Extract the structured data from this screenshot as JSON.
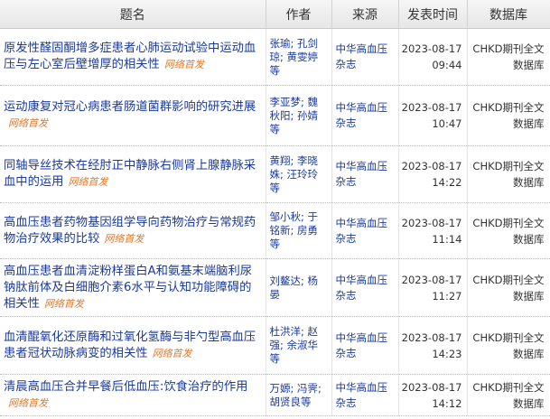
{
  "header": {
    "title": "题名",
    "author": "作者",
    "source": "来源",
    "date": "发表时间",
    "db": "数据库"
  },
  "badge": "网络首发",
  "rows": [
    {
      "title": "原发性醛固酮增多症患者心肺运动试验中运动血压与左心室后壁增厚的相关性",
      "author": "张瑜; 孔剑琼; 黄雯婷等",
      "source": "中华高血压杂志",
      "date": "2023-08-17",
      "time": "09:44",
      "db": "CHKD期刊全文数据库"
    },
    {
      "title": "运动康复对冠心病患者肠道菌群影响的研究进展",
      "author": "李亚梦; 魏秋阳; 孙婧等",
      "source": "中华高血压杂志",
      "date": "2023-08-17",
      "time": "10:47",
      "db": "CHKD期刊全文数据库"
    },
    {
      "title": "同轴导丝技术在经肘正中静脉右侧肾上腺静脉采血中的运用",
      "author": "黄翔; 李晓姝; 汪玲玲等",
      "source": "中华高血压杂志",
      "date": "2023-08-17",
      "time": "14:22",
      "db": "CHKD期刊全文数据库"
    },
    {
      "title": "高血压患者药物基因组学导向药物治疗与常规药物治疗效果的比较",
      "author": "邹小秋; 于铭新; 房勇等",
      "source": "中华高血压杂志",
      "date": "2023-08-17",
      "time": "11:14",
      "db": "CHKD期刊全文数据库"
    },
    {
      "title": "高血压患者血清淀粉样蛋白A和氨基末端脑利尿钠肽前体及白细胞介素6水平与认知功能障碍的相关性",
      "author": "刘鳌达; 杨晏",
      "source": "中华高血压杂志",
      "date": "2023-08-17",
      "time": "11:27",
      "db": "CHKD期刊全文数据库"
    },
    {
      "title": "血清醌氧化还原酶和过氧化氢酶与非勺型高血压患者冠状动脉病变的相关性",
      "author": "杜洪洋; 赵强; 余淑华等",
      "source": "中华高血压杂志",
      "date": "2023-08-17",
      "time": "14:23",
      "db": "CHKD期刊全文数据库"
    },
    {
      "title": "清晨高血压合并早餐后低血压:饮食治疗的作用",
      "author": "万嫄; 冯霁; 胡贤良等",
      "source": "中华高血压杂志",
      "date": "2023-08-17",
      "time": "14:12",
      "db": "CHKD期刊全文数据库"
    }
  ]
}
